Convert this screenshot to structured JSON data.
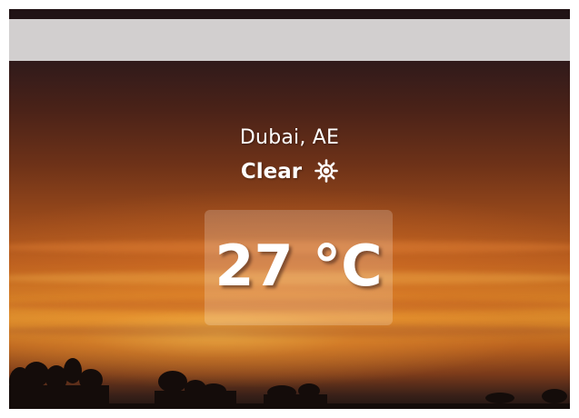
{
  "weather": {
    "location": "Dubai, AE",
    "condition": "Clear",
    "condition_icon": "sun-icon",
    "temperature": "27 °C"
  },
  "colors": {
    "text": "#ffffff",
    "search_bar_bg": "#d2cfcf",
    "sky_top": "#301a1b",
    "sky_glow": "#d88a2a"
  }
}
